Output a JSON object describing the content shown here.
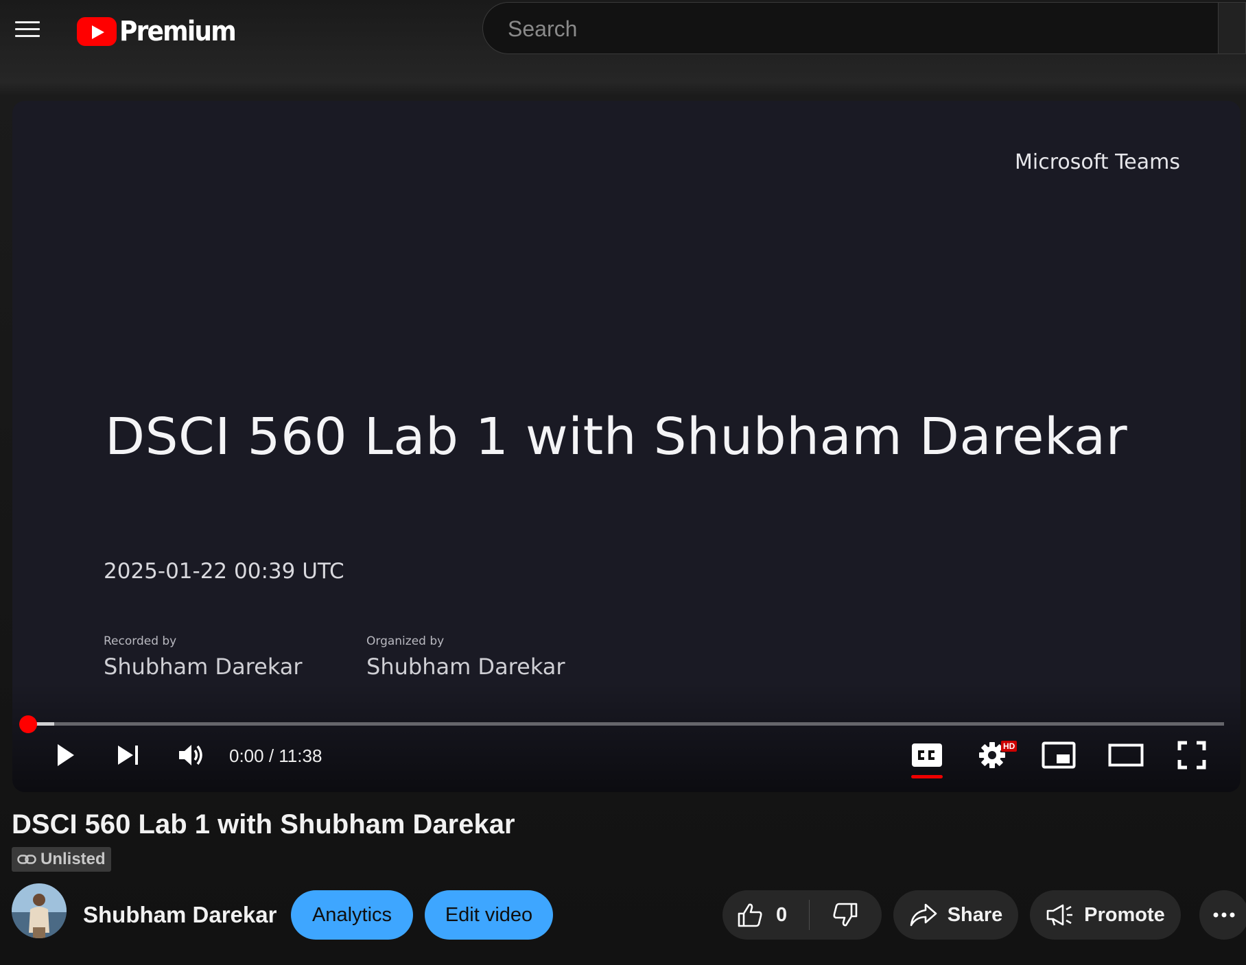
{
  "masthead": {
    "logo_text": "Premium",
    "search_placeholder": "Search"
  },
  "player": {
    "slide": {
      "brand": "Microsoft Teams",
      "title": "DSCI 560 Lab 1 with Shubham Darekar",
      "date": "2025-01-22 00:39 UTC",
      "recorded_by_label": "Recorded by",
      "recorded_by_name": "Shubham Darekar",
      "organized_by_label": "Organized by",
      "organized_by_name": "Shubham Darekar"
    },
    "time_display": "0:00 / 11:38",
    "progress_played_fraction": 0.0,
    "progress_buffered_fraction": 0.022,
    "hd_badge": "HD",
    "accent_color": "#ff0000"
  },
  "video": {
    "title": "DSCI 560 Lab 1 with Shubham Darekar",
    "visibility": "Unlisted",
    "channel_name": "Shubham Darekar",
    "like_count": "0"
  },
  "actions": {
    "analytics_label": "Analytics",
    "edit_label": "Edit video",
    "share_label": "Share",
    "promote_label": "Promote"
  },
  "colors": {
    "button_blue": "#3ea6ff",
    "button_dark": "#272727",
    "background": "#0f0f0f"
  }
}
